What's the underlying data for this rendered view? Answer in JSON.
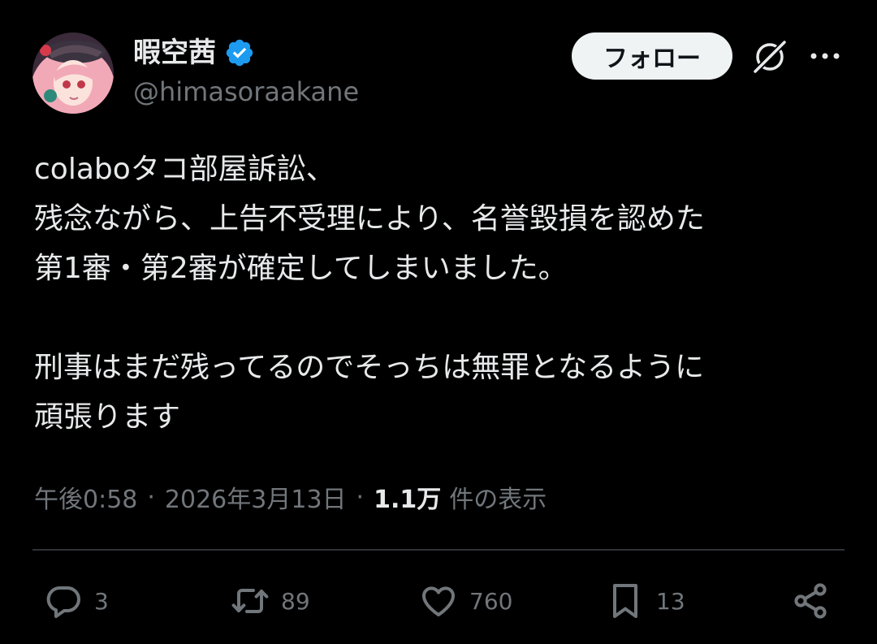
{
  "user": {
    "display_name": "暇空茜",
    "handle": "@himasoraakane"
  },
  "buttons": {
    "follow_label": "フォロー"
  },
  "icons": {
    "verified": "verified-badge-icon",
    "grok": "grok-icon",
    "more": "more-icon",
    "reply": "reply-icon",
    "retweet": "retweet-icon",
    "like": "heart-icon",
    "bookmark": "bookmark-icon",
    "share": "share-icon"
  },
  "tweet": {
    "lines": [
      "colaboタコ部屋訴訟、",
      "残念ながら、上告不受理により、名誉毀損を認めた",
      "第1審・第2審が確定してしまいました。",
      "",
      "刑事はまだ残ってるのでそっちは無罪となるように",
      "頑張ります"
    ]
  },
  "meta": {
    "time": "午後0:58",
    "separator": "·",
    "date": "2026年3月13日",
    "views_count": "1.1万",
    "views_label": "件の表示"
  },
  "actions": {
    "replies": "3",
    "retweets": "89",
    "likes": "760",
    "bookmarks": "13"
  },
  "colors": {
    "background": "#000000",
    "text": "#e7e9ea",
    "secondary": "#71767b",
    "verified": "#1d9bf0",
    "divider": "#2f3336",
    "follow_bg": "#eff3f4"
  }
}
